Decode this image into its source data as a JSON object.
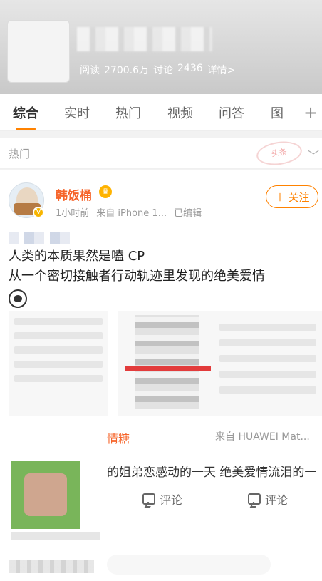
{
  "header": {
    "stats": {
      "read_label": "阅读",
      "read_count": "2700.6万",
      "discuss_label": "讨论",
      "discuss_count": "2436",
      "details_link": "详情>"
    }
  },
  "tabs": [
    {
      "label": "综合",
      "active": true
    },
    {
      "label": "实时"
    },
    {
      "label": "热门"
    },
    {
      "label": "视频"
    },
    {
      "label": "问答"
    },
    {
      "label": "图"
    }
  ],
  "hotbar": {
    "label": "热门",
    "stamp_text": "头条"
  },
  "post": {
    "user_name": "韩饭桶",
    "time": "1小时前",
    "source": "来自 iPhone 1...",
    "edited": "已编辑",
    "follow_label": "关注",
    "text_line_1": "人类的本质果然是嗑 CP",
    "text_line_2": "从一个密切接触者行动轨迹里发现的绝美爱情"
  },
  "embedded": {
    "name": "情糖",
    "source": "来自 HUAWEI Mat...",
    "text": "的姐弟恋感动的一天 绝美爱情流泪的一"
  },
  "actions": {
    "comment_label": "评论"
  },
  "colors": {
    "accent": "#ff8200",
    "username": "#f6642a"
  },
  "icons": {
    "plus": "plus-icon",
    "chevron": "chevron-down-icon",
    "comment": "comment-icon",
    "panda": "panda-emoji-icon",
    "crown": "crown-icon",
    "verified": "verified-badge-icon"
  }
}
